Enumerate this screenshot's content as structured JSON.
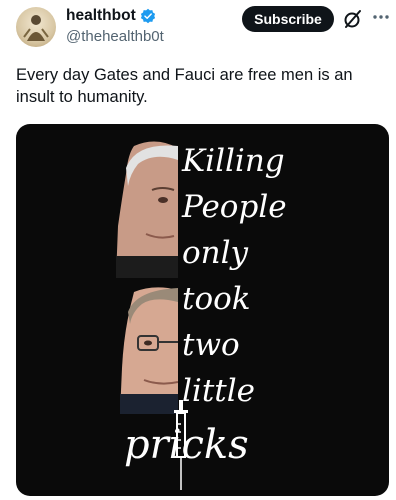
{
  "author": {
    "display_name": "healthbot",
    "handle": "@thehealthb0t",
    "verified": true
  },
  "actions": {
    "subscribe_label": "Subscribe",
    "grok_icon": "grok-slash-icon",
    "more_icon": "more-dots-icon"
  },
  "tweet": {
    "text": "Every day Gates and Fauci are free men is an insult to humanity."
  },
  "media": {
    "lines": [
      "Killing",
      "People",
      "only",
      "took",
      "two",
      "little"
    ],
    "last_line": "pricks",
    "syringe_icon": "syringe-icon"
  },
  "colors": {
    "text": "#0f1419",
    "muted": "#536471",
    "verified": "#1d9bf0",
    "media_bg": "#0a0a0a"
  }
}
